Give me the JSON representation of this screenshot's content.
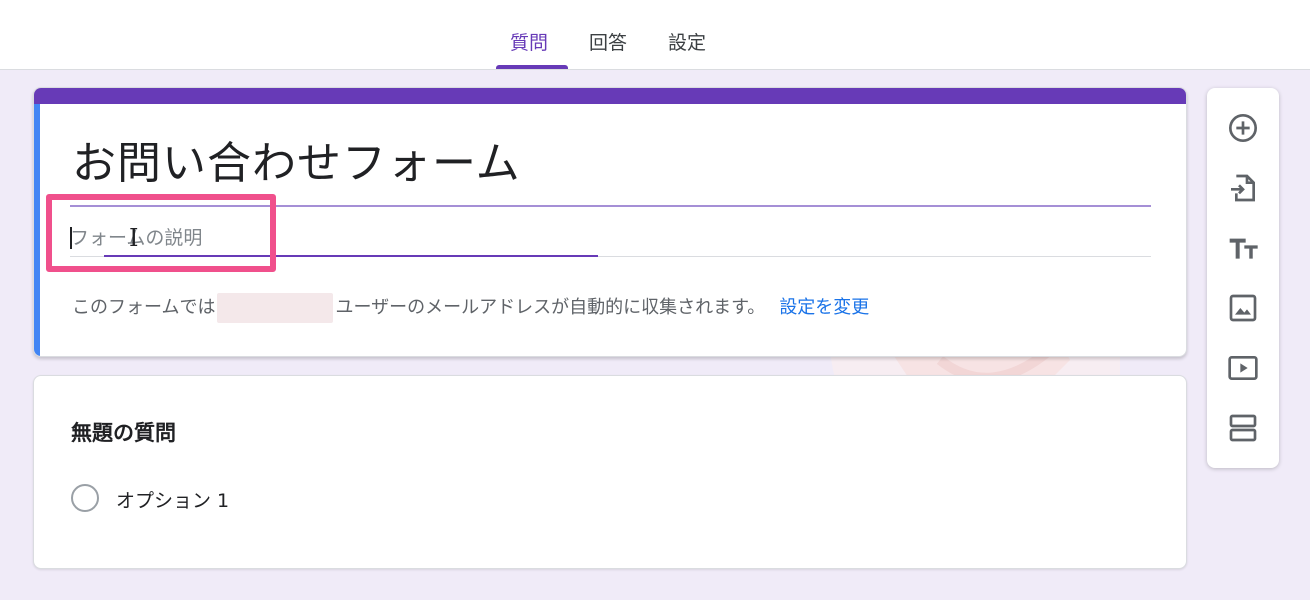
{
  "tabs": [
    {
      "label": "質問",
      "active": true
    },
    {
      "label": "回答",
      "active": false
    },
    {
      "label": "設定",
      "active": false
    }
  ],
  "form": {
    "title": "お問い合わせフォーム",
    "description_placeholder": "フォームの説明",
    "notice_prefix": "このフォームでは",
    "notice_suffix": "ユーザーのメールアドレスが自動的に収集されます。",
    "settings_link": "設定を変更"
  },
  "question": {
    "title": "無題の質問",
    "options": [
      "オプション 1"
    ]
  },
  "toolbar": {
    "items": [
      {
        "name": "add-question",
        "icon": "plus-circle-icon"
      },
      {
        "name": "import-questions",
        "icon": "import-icon"
      },
      {
        "name": "add-title-description",
        "icon": "text-size-icon"
      },
      {
        "name": "add-image",
        "icon": "image-icon"
      },
      {
        "name": "add-video",
        "icon": "video-icon"
      },
      {
        "name": "add-section",
        "icon": "section-icon"
      }
    ]
  },
  "colors": {
    "accent": "#673ab7",
    "left_accent": "#4285f4",
    "link": "#1a73e8",
    "highlight": "#f0508c",
    "background": "#f0ebf8"
  }
}
